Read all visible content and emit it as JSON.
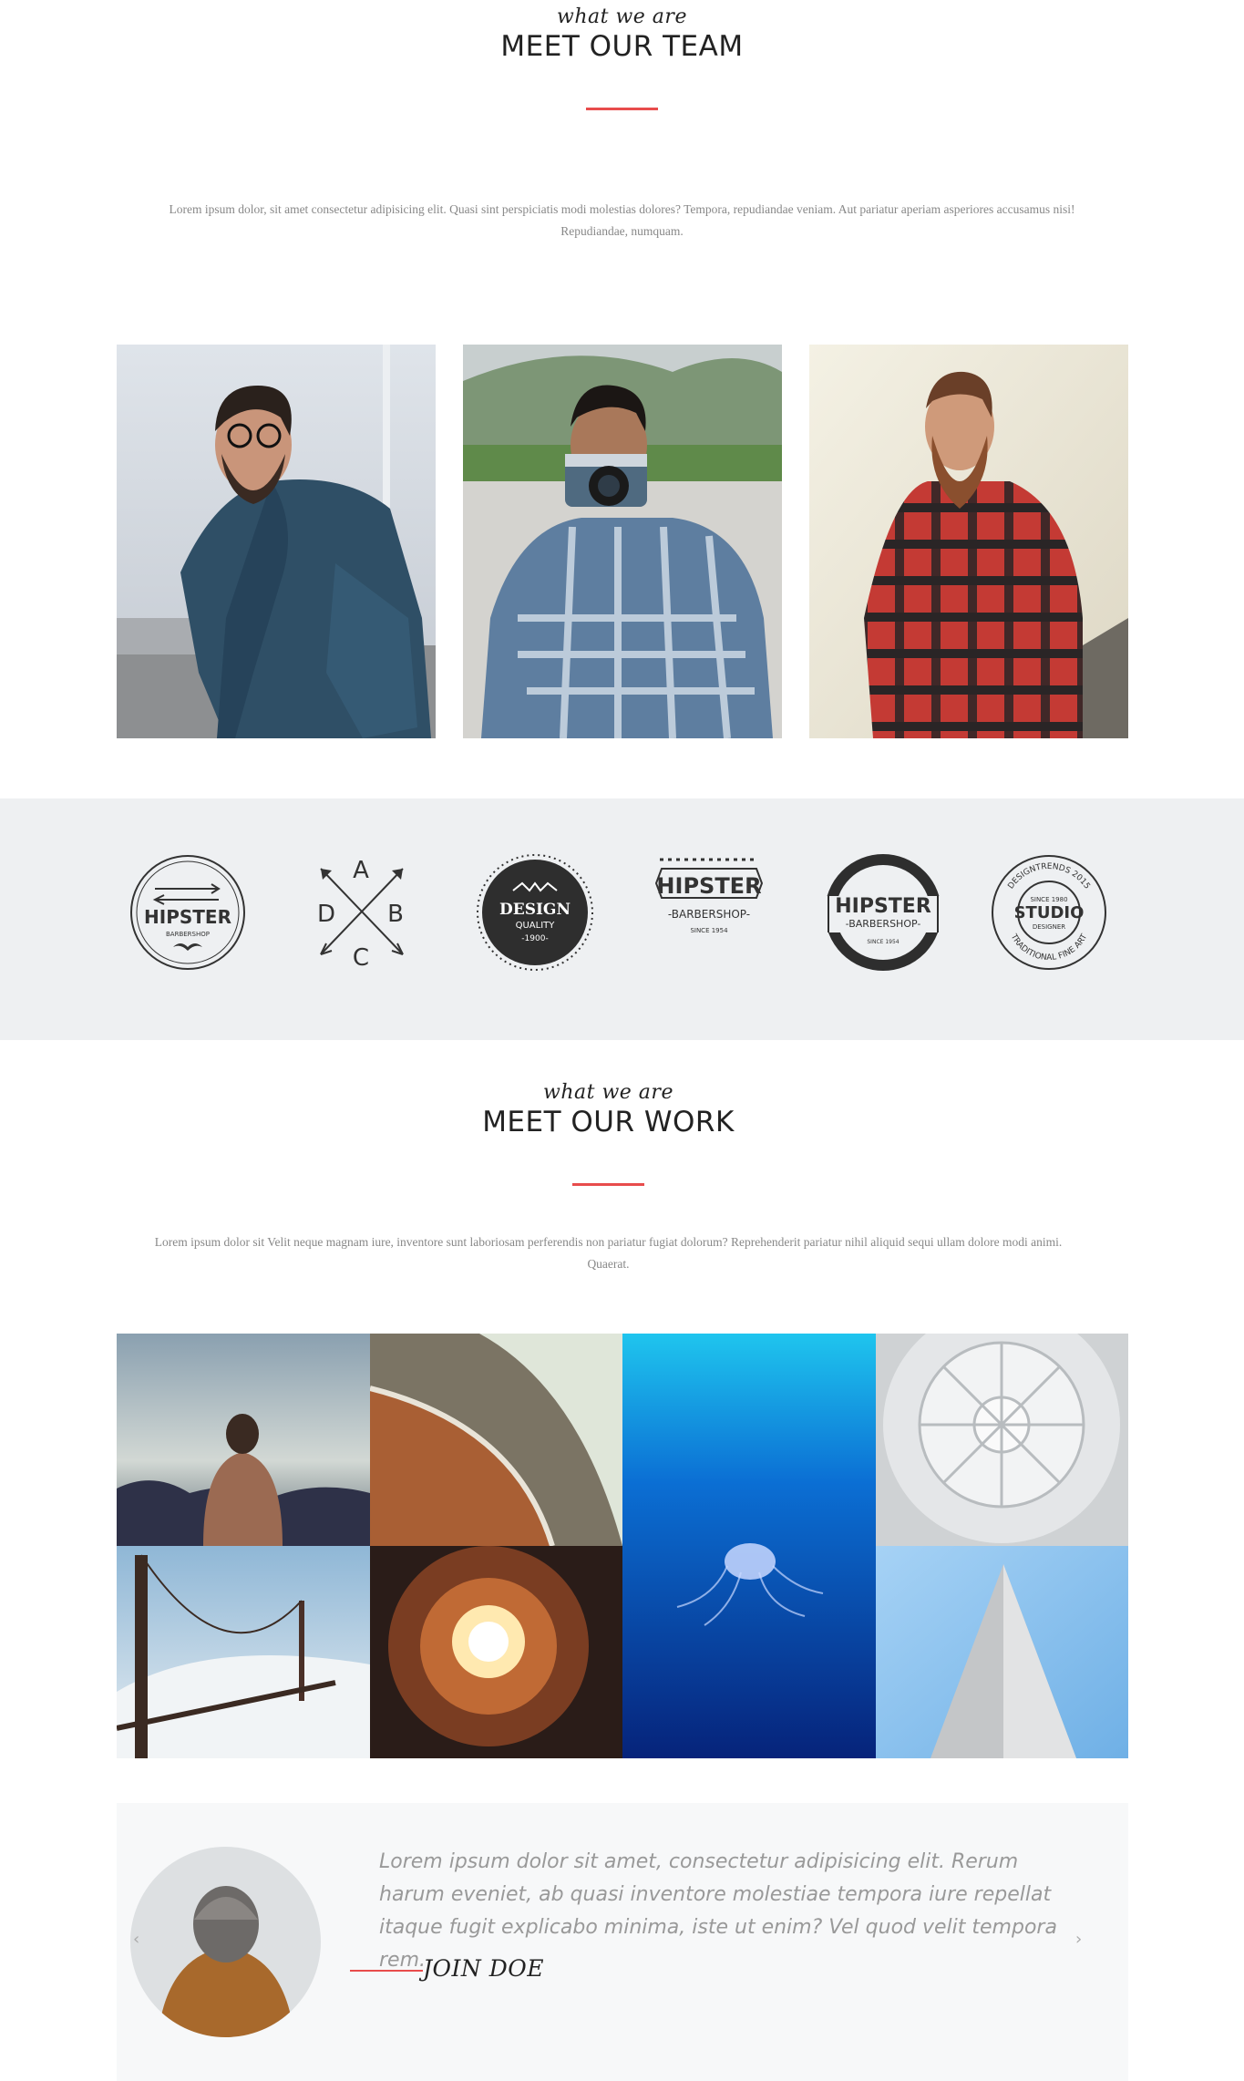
{
  "colors": {
    "accent": "#e84c4c",
    "band": "#eef0f2",
    "muted": "#888888"
  },
  "team_section": {
    "script_title": "what we are",
    "title": "MEET OUR TEAM",
    "intro": "Lorem ipsum dolor, sit amet consectetur adipisicing elit. Quasi sint perspiciatis modi molestias dolores? Tempora, repudiandae veniam. Aut pariatur aperiam asperiores accusamus nisi! Repudiandae, numquam."
  },
  "logos": [
    {
      "icon": "hipster-barbershop-badge-icon",
      "line1": "HIPSTER",
      "line2": "BARBERSHOP"
    },
    {
      "icon": "crossed-arrows-abcd-icon",
      "letters": [
        "A",
        "B",
        "C",
        "D"
      ]
    },
    {
      "icon": "design-quality-badge-icon",
      "line1": "DESIGN",
      "line2": "QUALITY",
      "line3": "-1900-"
    },
    {
      "icon": "hipster-barbershop-ribbon-icon",
      "line1": "HIPSTER",
      "line2": "-BARBERSHOP-",
      "line3": "SINCE 1954"
    },
    {
      "icon": "hipster-barbershop-ring-icon",
      "line1": "HIPSTER",
      "line2": "-BARBERSHOP-",
      "line3": "SINCE 1954"
    },
    {
      "icon": "studio-designer-seal-icon",
      "line1": "SINCE 1980",
      "line2": "STUDIO",
      "line3": "DESIGNER",
      "ring_top": "DESIGNTRENDS 2015",
      "ring_bottom": "TRADITIONAL FINE ART"
    }
  ],
  "work_section": {
    "script_title": "what we are",
    "title": "MEET OUR WORK",
    "intro": "Lorem ipsum dolor sit Velit neque magnam iure, inventore sunt laboriosam perferendis non pariatur fugiat dolorum? Reprehenderit pariatur nihil aliquid sequi ullam dolore modi animi. Quaerat."
  },
  "testimonial": {
    "quote": "Lorem ipsum dolor sit amet, consectetur adipisicing elit. Rerum harum eveniet, ab quasi inventore molestiae tempora iure repellat itaque fugit explicabo minima, iste ut enim? Vel quod velit tempora rem.",
    "author": "JOIN DOE",
    "prev_icon": "‹",
    "next_icon": "›"
  }
}
